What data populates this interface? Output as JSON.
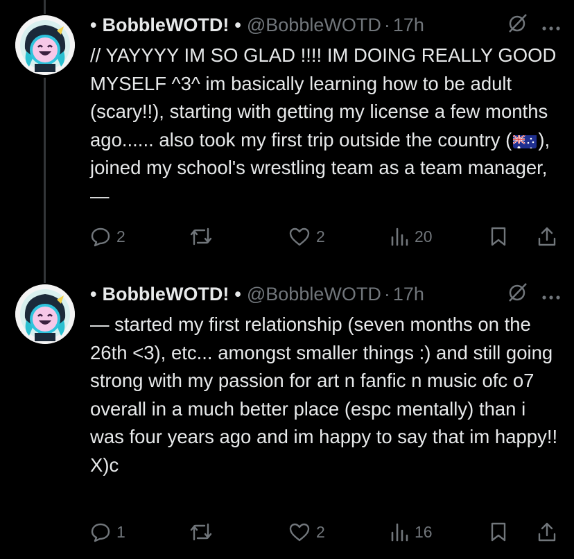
{
  "tweets": [
    {
      "display_name": "BobbleWOTD!",
      "handle": "@BobbleWOTD",
      "time": "17h",
      "text_before_flag": "// YAYYYY IM SO GLAD !!!! IM DOING REALLY GOOD MYSELF ^3^ im basically learning how to be adult (scary!!), starting with getting my license a few months ago...... also took my first trip outside the country (",
      "flag": "🇦🇺",
      "text_after_flag": "), joined my school's wrestling team as a team manager, —",
      "replies": "2",
      "likes": "2",
      "views": "20"
    },
    {
      "display_name": "BobbleWOTD!",
      "handle": "@BobbleWOTD",
      "time": "17h",
      "text": "— started my first relationship (seven months on the 26th <3), etc... amongst smaller things :) and still going strong with my passion for art n fanfic n music ofc o7 overall in a much better place (espc mentally) than i was four years ago and im happy to say that im happy!! X)c",
      "replies": "1",
      "likes": "2",
      "views": "16"
    }
  ],
  "bullet": "•",
  "separator": "•",
  "dot": "·",
  "colors": {
    "background": "#000000",
    "text": "#e7e9ea",
    "muted": "#71767b",
    "thread_line": "#333639"
  }
}
